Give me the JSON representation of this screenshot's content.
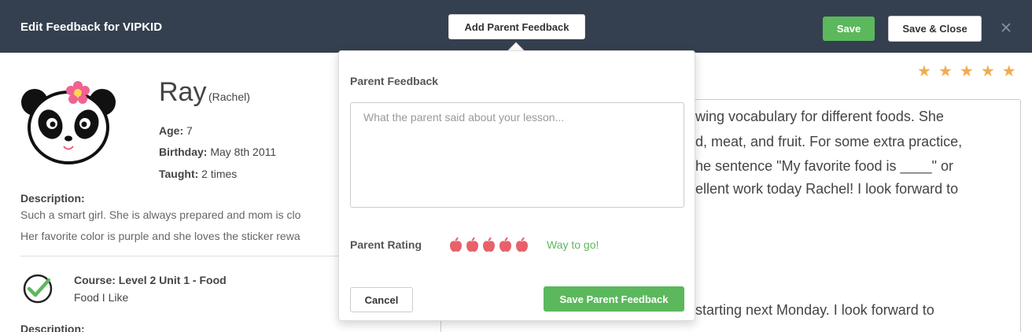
{
  "header": {
    "title": "Edit Feedback for VIPKID",
    "add_parent_feedback_label": "Add Parent Feedback",
    "save_label": "Save",
    "save_close_label": "Save & Close"
  },
  "student": {
    "name": "Ray",
    "alias": "(Rachel)",
    "age_label": "Age:",
    "age": "7",
    "birthday_label": "Birthday:",
    "birthday": "May 8th 2011",
    "taught_label": "Taught:",
    "taught": "2 times",
    "description_heading": "Description:",
    "description_line1": "Such a smart girl. She is always prepared and mom is clo",
    "description_line2": "Her favorite color is purple and she loves the sticker rewa"
  },
  "course": {
    "title": "Course: Level 2 Unit 1 - Food",
    "subtitle": "Food I Like",
    "description_heading": "Description:"
  },
  "feedback": {
    "star_rating": 5,
    "lines": [
      "wing vocabulary for different foods. She",
      "d, meat, and fruit. For some extra practice,",
      "he sentence \"My favorite food is ____\" or",
      "ellent work today Rachel! I look forward to",
      "starting next Monday. I look forward to"
    ]
  },
  "popover": {
    "title": "Parent Feedback",
    "placeholder": "What the parent said about your lesson...",
    "rating_label": "Parent Rating",
    "apple_rating": 5,
    "rating_text": "Way to go!",
    "cancel_label": "Cancel",
    "save_label": "Save Parent Feedback"
  },
  "colors": {
    "header_bg": "#34404f",
    "green": "#5cb85c",
    "star": "#f0ad4e",
    "apple": "#e8606a"
  }
}
